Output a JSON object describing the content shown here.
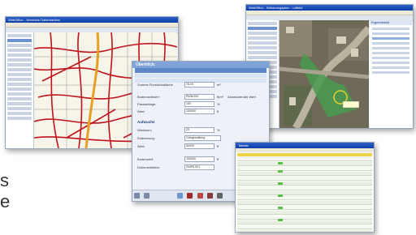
{
  "left_window": {
    "title": "WebOffice - Vernetzte Datenbanken",
    "sidebar_rows": 18
  },
  "form_window": {
    "title": "Überblick:",
    "fields": [
      {
        "label": "Summe Flurstücksfläche",
        "value": "78,00",
        "unit": "m²"
      },
      {
        "label": "Bodenrichtwert:",
        "value": "RWB/200",
        "unit": "€/m²"
      },
      {
        "label": "Passantlage:",
        "value": "100",
        "unit": "%"
      },
      {
        "label": "Wert:",
        "value": "100000",
        "unit": "€"
      },
      {
        "label": "Werkwert:",
        "value": "25",
        "unit": "%"
      },
      {
        "label": "Erläuterung:",
        "value": "Ortsgestaltung",
        "unit": ""
      },
      {
        "label": "Wert:",
        "value": "50000",
        "unit": "€"
      },
      {
        "label": "Bodenwert:",
        "value": "150000",
        "unit": "€"
      },
      {
        "label": "Dokumentation:",
        "value": "SWPA 001",
        "unit": ""
      }
    ],
    "extra_label": "Abweichender Wert",
    "section_label": "Aufwuchs"
  },
  "right_top_window": {
    "title": "WebOffice - Bebauungsplan - Luftbild",
    "panel_title": "Ergebnisbild"
  },
  "table_window": {
    "title": "Tabelle"
  },
  "side_text": [
    "s",
    "e"
  ],
  "colors": {
    "titlebar": "#0c3fa7",
    "map_road": "#c0121b",
    "ortho_green": "#4a9a4f",
    "accent": "#5d86c4"
  }
}
